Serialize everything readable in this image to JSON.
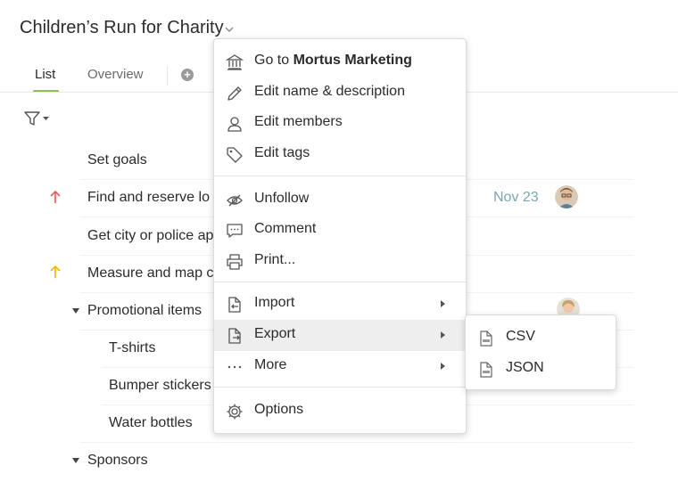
{
  "header": {
    "title": "Children’s Run for Charity"
  },
  "tabs": [
    {
      "label": "List",
      "active": true
    },
    {
      "label": "Overview",
      "active": false
    }
  ],
  "tasks": [
    {
      "name": "Set goals",
      "priority": "",
      "indent": 0,
      "collapsible": false
    },
    {
      "name": "Find and reserve lo",
      "priority": "high",
      "due": "Nov 23",
      "indent": 0,
      "collapsible": false,
      "assignee": "avatar-man"
    },
    {
      "name": "Get city or police ap",
      "priority": "",
      "indent": 0,
      "collapsible": false
    },
    {
      "name": "Measure and map c",
      "priority": "medium",
      "indent": 0,
      "collapsible": false
    },
    {
      "name": "Promotional items",
      "priority": "",
      "indent": 0,
      "collapsible": true,
      "assignee": "avatar-woman"
    },
    {
      "name": "T-shirts",
      "priority": "",
      "indent": 1,
      "collapsible": false
    },
    {
      "name": "Bumper stickers",
      "priority": "",
      "indent": 1,
      "collapsible": false
    },
    {
      "name": "Water bottles",
      "priority": "",
      "indent": 1,
      "collapsible": false
    },
    {
      "name": "Sponsors",
      "priority": "",
      "indent": 0,
      "collapsible": true
    }
  ],
  "menu": {
    "goto_prefix": "Go to ",
    "goto_target": "Mortus Marketing",
    "edit_name": "Edit name & description",
    "edit_members": "Edit members",
    "edit_tags": "Edit tags",
    "unfollow": "Unfollow",
    "comment": "Comment",
    "print": "Print...",
    "import": "Import",
    "export": "Export",
    "more": "More",
    "options": "Options"
  },
  "export_submenu": {
    "csv": "CSV",
    "json": "JSON"
  },
  "colors": {
    "priority_high": "#e05c5c",
    "priority_medium": "#f0b400",
    "tab_active_underline": "#8cc152",
    "due_date": "#7aa7b0"
  }
}
